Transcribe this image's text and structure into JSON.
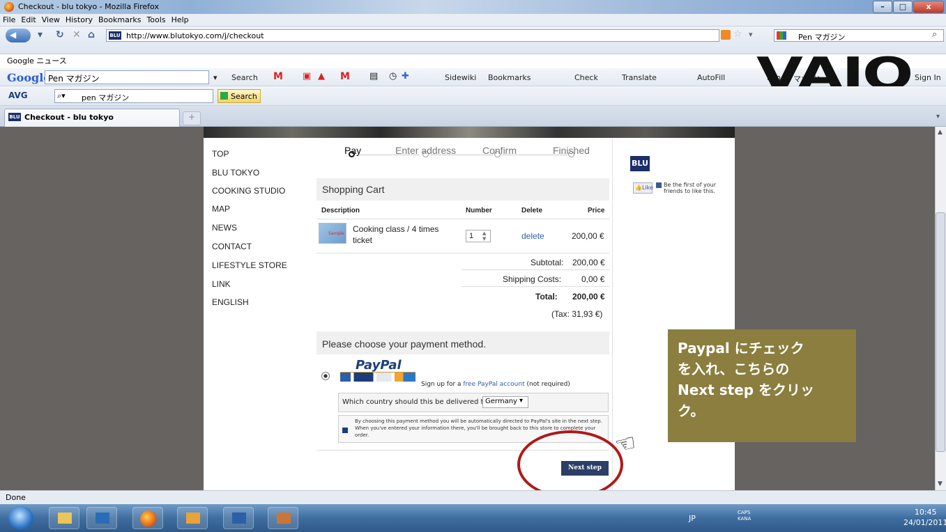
{
  "window": {
    "title": "Checkout - blu tokyo - Mozilla Firefox",
    "min": "–",
    "max": "□",
    "close": "x"
  },
  "menu": [
    "File",
    "Edit",
    "View",
    "History",
    "Bookmarks",
    "Tools",
    "Help"
  ],
  "nav": {
    "url": "http://www.blutokyo.com/j/checkout",
    "favicon": "BLU",
    "search_text": "Pen マガジン"
  },
  "bookmarks": {
    "item1": "Google ニュース"
  },
  "google_toolbar": {
    "logo": "Google",
    "query": "Pen マガジン",
    "items": [
      "Search",
      "Sidewiki",
      "Bookmarks",
      "Check",
      "Translate",
      "AutoFill",
      "Pen",
      "マガジン",
      "Sign In"
    ]
  },
  "brand_overlay": "VAIO",
  "avg_toolbar": {
    "logo": "AVG",
    "query": "pen マガジン",
    "search_btn": "Search"
  },
  "tabs": [
    {
      "label": "Checkout - blu tokyo",
      "favicon": "BLU"
    }
  ],
  "tab_new": "+",
  "site_nav": [
    "TOP",
    "BLU TOKYO",
    "COOKING STUDIO",
    "MAP",
    "NEWS",
    "CONTACT",
    "LIFESTYLE STORE",
    "LINK",
    "ENGLISH"
  ],
  "steps": [
    "Pay",
    "Enter address",
    "Confirm",
    "Finished"
  ],
  "cart": {
    "title": "Shopping Cart",
    "headers": {
      "description": "Description",
      "number": "Number",
      "delete": "Delete",
      "price": "Price"
    },
    "item": {
      "thumb_label": "Sample",
      "name_line1": "Cooking class / 4 times",
      "name_line2": "ticket",
      "qty": "1",
      "delete": "delete",
      "price": "200,00 €"
    },
    "subtotal_label": "Subtotal:",
    "subtotal": "200,00 €",
    "shipping_label": "Shipping Costs:",
    "shipping": "0,00 €",
    "total_label": "Total:",
    "total": "200,00 €",
    "tax": "(Tax: 31,93 €)"
  },
  "payment": {
    "title": "Please choose your payment method.",
    "paypal_logo": "PayPal",
    "card_labels": [
      "giropay",
      "VISA"
    ],
    "signup_pre": "Sign up for a ",
    "signup_link": "free PayPal account",
    "signup_post": " (not required)",
    "country_label": "Which country should this be delivered to?",
    "country_value": "Germany",
    "info": "By choosing this payment method you will be automatically directed to PayPal's site in the next step. When you've entered your information there, you'll be brought back to this store to complete your order.",
    "next_step": "Next step"
  },
  "right": {
    "logo": "BLU",
    "like": "Like",
    "like_text_1": "Be the first of your",
    "like_text_2": "friends to like this."
  },
  "annotation": {
    "line1": "Paypal にチェック",
    "line2": "を入れ、こちらの",
    "line3": "Next step をクリッ",
    "line4": "ク。"
  },
  "status": "Done",
  "tray": {
    "lang": "JP",
    "caps": "CAPS",
    "kana": "KANA",
    "time": "10:45",
    "date": "24/01/2011"
  },
  "colors": {
    "annotation_bg": "#8b7e3e",
    "circle": "#b01818",
    "next_btn": "#2b3e66",
    "link": "#2d5fa8"
  }
}
